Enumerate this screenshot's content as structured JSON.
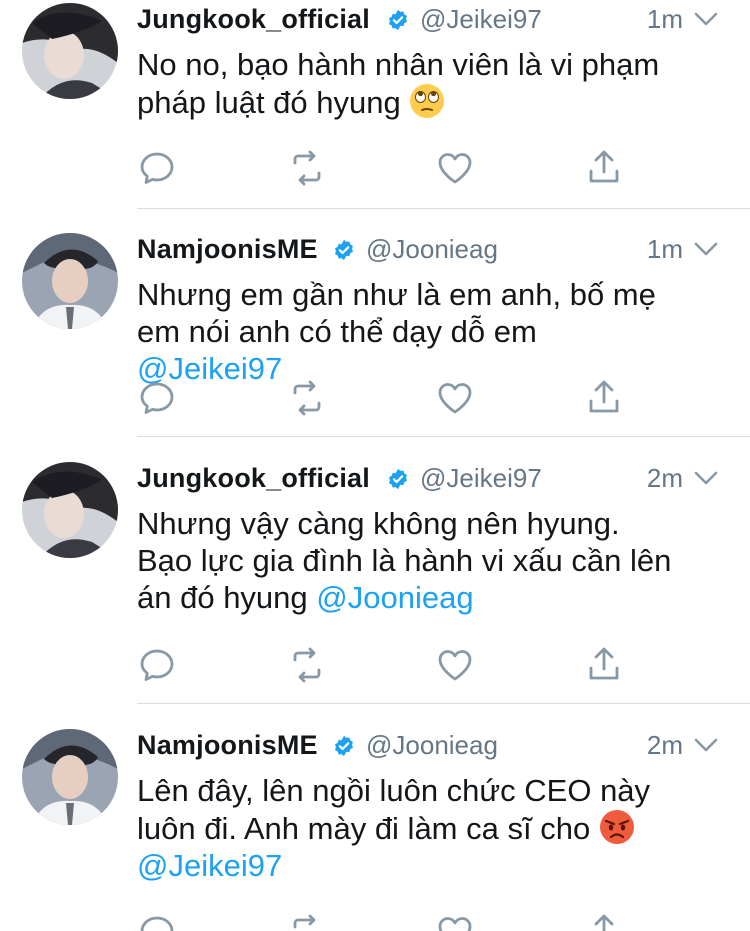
{
  "colors": {
    "link": "#1da1f2",
    "meta": "#657786",
    "icon": "#8899a6",
    "verified": "#1da1f2",
    "divider": "#d7dde1"
  },
  "tweets": [
    {
      "name": "Jungkook_official",
      "handle": "@Jeikei97",
      "time": "1m",
      "text_lines": [
        "No no, bạo hành nhân viên là vi phạm",
        "pháp luật đó hyung"
      ],
      "mention": "",
      "emoji": "face-with-rolling-eyes"
    },
    {
      "name": "NamjoonisME",
      "handle": "@Joonieag",
      "time": "1m",
      "text_lines": [
        "Nhưng em  gần như là em anh, bố mẹ",
        "em nói anh có thể dạy dỗ em"
      ],
      "mention": "@Jeikei97",
      "emoji": ""
    },
    {
      "name": "Jungkook_official",
      "handle": "@Jeikei97",
      "time": "2m",
      "text_lines": [
        "Nhưng vậy càng không nên hyung.",
        "Bạo lực gia đình là hành vi xấu cần lên",
        "án đó hyung "
      ],
      "mention": "@Joonieag",
      "emoji": ""
    },
    {
      "name": "NamjoonisME",
      "handle": "@Joonieag",
      "time": "2m",
      "text_lines": [
        "Lên đây, lên ngồi luôn chức CEO này",
        "luôn đi. Anh mày đi làm ca sĩ cho"
      ],
      "mention": "@Jeikei97",
      "emoji": "pouting-face"
    }
  ]
}
